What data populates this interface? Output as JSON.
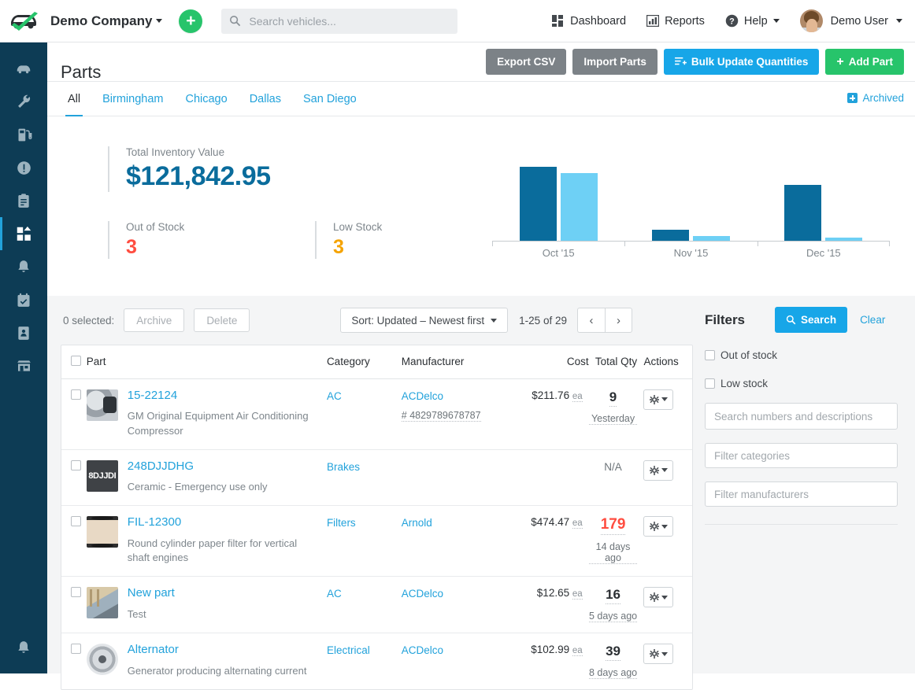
{
  "topnav": {
    "logo_icon": "car-check-logo",
    "brand": "Demo Company",
    "add_icon": "plus-icon",
    "search": {
      "icon": "search-icon",
      "value": "",
      "placeholder": "Search vehicles..."
    },
    "items": [
      {
        "label": "Dashboard",
        "icon": "dashboard-grid-icon"
      },
      {
        "label": "Reports",
        "icon": "bar-chart-icon"
      },
      {
        "label": "Help",
        "icon": "question-circle-icon",
        "caret": true
      }
    ],
    "user": {
      "label": "Demo User",
      "avatar": "user-avatar",
      "caret": true
    }
  },
  "sidebar": {
    "items": [
      {
        "name": "vehicles",
        "icon": "car-icon",
        "active": false
      },
      {
        "name": "service",
        "icon": "wrench-icon",
        "active": false
      },
      {
        "name": "fuel",
        "icon": "fuel-pump-icon",
        "active": false
      },
      {
        "name": "issues",
        "icon": "alert-circle-icon",
        "active": false
      },
      {
        "name": "inspections",
        "icon": "clipboard-icon",
        "active": false
      },
      {
        "name": "parts",
        "icon": "parts-grid-icon",
        "active": true
      },
      {
        "name": "reminders",
        "icon": "bell-icon",
        "active": false
      },
      {
        "name": "schedule",
        "icon": "calendar-check-icon",
        "active": false
      },
      {
        "name": "contacts",
        "icon": "contact-card-icon",
        "active": false
      },
      {
        "name": "vendors",
        "icon": "shop-icon",
        "active": false
      }
    ],
    "bottom": {
      "name": "notifications",
      "icon": "bell-icon"
    }
  },
  "page": {
    "title": "Parts",
    "actions": [
      {
        "label": "Export CSV",
        "style": "grey",
        "icon": null
      },
      {
        "label": "Import Parts",
        "style": "grey",
        "icon": null
      },
      {
        "label": "Bulk Update Quantities",
        "style": "blue",
        "icon": "list-plus-icon"
      },
      {
        "label": "Add Part",
        "style": "green",
        "icon": "plus-icon"
      }
    ]
  },
  "tabs": {
    "items": [
      {
        "label": "All",
        "active": true
      },
      {
        "label": "Birmingham",
        "active": false
      },
      {
        "label": "Chicago",
        "active": false
      },
      {
        "label": "Dallas",
        "active": false
      },
      {
        "label": "San Diego",
        "active": false
      }
    ],
    "archived": {
      "label": "Archived",
      "icon": "archive-box-icon"
    }
  },
  "stats": {
    "total": {
      "label": "Total Inventory Value",
      "value": "$121,842.95",
      "color": "#0a6c9c"
    },
    "out_of_stock": {
      "label": "Out of Stock",
      "value": "3",
      "color": "#ff4d40"
    },
    "low_stock": {
      "label": "Low Stock",
      "value": "3",
      "color": "#f5a300"
    }
  },
  "chart_data": {
    "type": "bar",
    "title": "",
    "xlabel": "",
    "ylabel": "",
    "grid": false,
    "legend": "none",
    "categories": [
      "Oct '15",
      "Nov '15",
      "Dec '15"
    ],
    "ylim": [
      0,
      100
    ],
    "series": [
      {
        "name": "series-dark",
        "color": "#0a6c9c",
        "values": [
          96,
          14,
          72
        ]
      },
      {
        "name": "series-light",
        "color": "#6ed0f5",
        "values": [
          88,
          6,
          4
        ]
      }
    ]
  },
  "toolbar": {
    "selected_text": "0 selected:",
    "archive_label": "Archive",
    "delete_label": "Delete",
    "sort_label": "Sort: Updated – Newest first",
    "page_count": "1-25 of 29",
    "prev_icon": "chevron-left-icon",
    "next_icon": "chevron-right-icon"
  },
  "table": {
    "columns": [
      "Part",
      "Category",
      "Manufacturer",
      "Cost",
      "Total Qty",
      "Actions"
    ],
    "rows": [
      {
        "thumb": "compressor",
        "thumb_text": "",
        "name": "15-22124",
        "desc": "GM Original Equipment Air Conditioning Compressor",
        "category": "AC",
        "manufacturer": "ACDelco",
        "manufacturer_number": "# 4829789678787",
        "cost": "$211.76",
        "cost_unit": "ea",
        "qty": "9",
        "qty_low": false,
        "updated": "Yesterday"
      },
      {
        "thumb": "dark",
        "thumb_text": "8DJJDI",
        "name": "248DJJDHG",
        "desc": "Ceramic - Emergency use only",
        "category": "Brakes",
        "manufacturer": "",
        "manufacturer_number": "",
        "cost": "",
        "cost_unit": "",
        "qty": "N/A",
        "qty_low": false,
        "updated": ""
      },
      {
        "thumb": "filter",
        "thumb_text": "",
        "name": "FIL-12300",
        "desc": "Round cylinder paper filter for vertical shaft engines",
        "category": "Filters",
        "manufacturer": "Arnold",
        "manufacturer_number": "",
        "cost": "$474.47",
        "cost_unit": "ea",
        "qty": "179",
        "qty_low": true,
        "updated": "14 days ago"
      },
      {
        "thumb": "photo",
        "thumb_text": "",
        "name": "New part",
        "desc": "Test",
        "category": "AC",
        "manufacturer": "ACDelco",
        "manufacturer_number": "",
        "cost": "$12.65",
        "cost_unit": "ea",
        "qty": "16",
        "qty_low": false,
        "updated": "5 days ago"
      },
      {
        "thumb": "alt",
        "thumb_text": "",
        "name": "Alternator",
        "desc": "Generator producing alternating current",
        "category": "Electrical",
        "manufacturer": "ACDelco",
        "manufacturer_number": "",
        "cost": "$102.99",
        "cost_unit": "ea",
        "qty": "39",
        "qty_low": false,
        "updated": "8 days ago"
      }
    ]
  },
  "filters": {
    "title": "Filters",
    "search_label": "Search",
    "search_icon": "search-icon",
    "clear_label": "Clear",
    "checkboxes": [
      {
        "label": "Out of stock",
        "checked": false
      },
      {
        "label": "Low stock",
        "checked": false
      }
    ],
    "inputs": [
      {
        "name": "numbers-desc",
        "value": "",
        "placeholder": "Search numbers and descriptions"
      },
      {
        "name": "categories",
        "value": "",
        "placeholder": "Filter categories"
      },
      {
        "name": "manufacturers",
        "value": "",
        "placeholder": "Filter manufacturers"
      }
    ]
  },
  "colors": {
    "accent_blue": "#22a2db",
    "dark_blue": "#0a6c9c",
    "light_blue": "#6ed0f5",
    "green": "#27c46b",
    "red": "#ff4d40",
    "amber": "#f5a300",
    "sidebar": "#0d3c55"
  }
}
